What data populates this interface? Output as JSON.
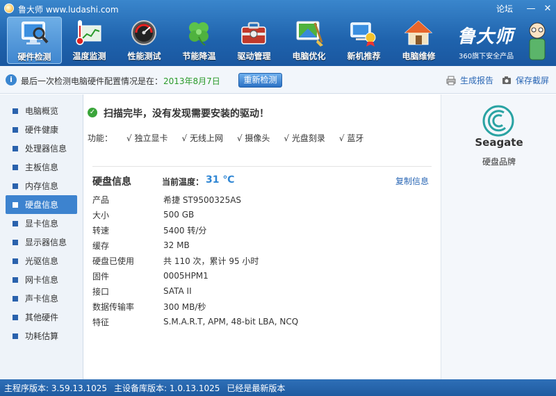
{
  "window": {
    "title": "鲁大师 www.ludashi.com",
    "forum": "论坛",
    "minimize": "—",
    "close": "✕"
  },
  "nav": {
    "items": [
      {
        "label": "硬件检测",
        "icon": "monitor-magnifier-icon",
        "active": true
      },
      {
        "label": "温度监测",
        "icon": "thermometer-icon"
      },
      {
        "label": "性能测试",
        "icon": "speedometer-icon"
      },
      {
        "label": "节能降温",
        "icon": "clover-icon"
      },
      {
        "label": "驱动管理",
        "icon": "toolbox-icon"
      },
      {
        "label": "电脑优化",
        "icon": "screen-broom-icon"
      },
      {
        "label": "新机推荐",
        "icon": "computer-medal-icon"
      },
      {
        "label": "电脑维修",
        "icon": "house-icon"
      }
    ]
  },
  "brand": {
    "name": "鲁大师",
    "tagline": "360旗下安全产品"
  },
  "infobar": {
    "text": "最后一次检测电脑硬件配置情况是在：",
    "date": "2013年8月7日",
    "recheck": "重新检测",
    "report": "生成报告",
    "screenshot": "保存截屏"
  },
  "sidebar": {
    "items": [
      {
        "label": "电脑概览"
      },
      {
        "label": "硬件健康"
      },
      {
        "label": "处理器信息"
      },
      {
        "label": "主板信息"
      },
      {
        "label": "内存信息"
      },
      {
        "label": "硬盘信息",
        "active": true
      },
      {
        "label": "显卡信息"
      },
      {
        "label": "显示器信息"
      },
      {
        "label": "光驱信息"
      },
      {
        "label": "网卡信息"
      },
      {
        "label": "声卡信息"
      },
      {
        "label": "其他硬件"
      },
      {
        "label": "功耗估算"
      }
    ]
  },
  "main": {
    "scan_message": "扫描完毕，没有发现需要安装的驱动！",
    "features_label": "功能：",
    "features": [
      "√ 独立显卡",
      "√ 无线上网",
      "√ 摄像头",
      "√ 光盘刻录",
      "√ 蓝牙"
    ],
    "section_title": "硬盘信息",
    "temp_label": "当前温度：",
    "temp_value": "31 ℃",
    "copy_info": "复制信息",
    "rows": [
      {
        "label": "产品",
        "value": "希捷 ST9500325AS"
      },
      {
        "label": "大小",
        "value": "500 GB"
      },
      {
        "label": "转速",
        "value": "5400 转/分"
      },
      {
        "label": "缓存",
        "value": "32 MB"
      },
      {
        "label": "硬盘已使用",
        "value": "共 110 次，累计 95 小时"
      },
      {
        "label": "固件",
        "value": "0005HPM1"
      },
      {
        "label": "接口",
        "value": "SATA II"
      },
      {
        "label": "数据传输率",
        "value": "300 MB/秒"
      },
      {
        "label": "特征",
        "value": "S.M.A.R.T,  APM,  48-bit LBA,  NCQ"
      }
    ]
  },
  "rightpanel": {
    "logo_text": "Seagate",
    "caption": "硬盘品牌"
  },
  "status": {
    "main_version": "主程序版本: 3.59.13.1025",
    "db_version": "主设备库版本: 1.0.13.1025",
    "latest": "已经是最新版本"
  }
}
